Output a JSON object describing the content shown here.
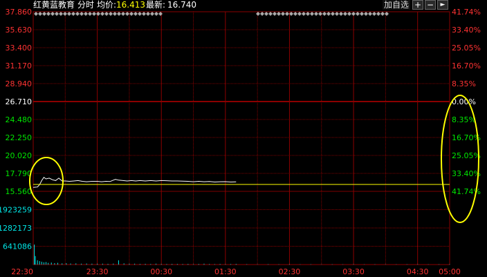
{
  "header": {
    "stock_name": "红黄蓝教育",
    "mode": "分时",
    "avg_label": "均价:",
    "avg_value": "16.413",
    "latest_label": "最新:",
    "latest_value": "16.740",
    "add_watchlist": "加自选",
    "btn_plus": "+",
    "btn_minus": "−",
    "btn_right": "►"
  },
  "colors": {
    "up": "#ff3232",
    "down": "#00e600",
    "grid": "#8c0000",
    "volume": "#00e6e6",
    "text": "#ffffff",
    "avg": "#ffff00",
    "price_line": "#ffffff",
    "annotation": "#ffff00"
  },
  "icons": {
    "plus": "plus-icon",
    "minus": "minus-icon",
    "right": "arrow-right-icon"
  },
  "chart_data": {
    "type": "line",
    "title": "",
    "prev_close": 26.71,
    "price_ticks": [
      "37.860",
      "35.630",
      "33.400",
      "31.170",
      "28.940",
      "26.710",
      "24.480",
      "22.250",
      "20.020",
      "17.790",
      "15.560"
    ],
    "percent_ticks": [
      "41.74%",
      "33.40%",
      "25.05%",
      "16.70%",
      "8.35%",
      "0.00%",
      "8.35%",
      "16.70%",
      "25.05%",
      "33.40%",
      "41.74%"
    ],
    "volume_ticks": [
      "1923259",
      "1282173",
      "641086"
    ],
    "time_ticks": [
      "22:30",
      "23:30",
      "00:30",
      "01:30",
      "02:30",
      "03:30",
      "04:30",
      "05:00"
    ],
    "ylim": [
      15.56,
      37.86
    ],
    "volume_max": 2564345,
    "price_series": [
      [
        0,
        16.05
      ],
      [
        4,
        16.1
      ],
      [
        6,
        16.4
      ],
      [
        8,
        16.9
      ],
      [
        10,
        17.3
      ],
      [
        12,
        17.1
      ],
      [
        15,
        17.2
      ],
      [
        18,
        17.0
      ],
      [
        21,
        16.9
      ],
      [
        24,
        17.2
      ],
      [
        27,
        16.85
      ],
      [
        30,
        16.85
      ],
      [
        34,
        16.8
      ],
      [
        38,
        16.85
      ],
      [
        42,
        16.9
      ],
      [
        46,
        16.8
      ],
      [
        50,
        16.75
      ],
      [
        55,
        16.8
      ],
      [
        60,
        16.8
      ],
      [
        64,
        16.75
      ],
      [
        68,
        16.8
      ],
      [
        72,
        16.78
      ],
      [
        75,
        16.95
      ],
      [
        77,
        17.05
      ],
      [
        80,
        16.95
      ],
      [
        84,
        16.9
      ],
      [
        88,
        16.85
      ],
      [
        92,
        16.9
      ],
      [
        96,
        16.85
      ],
      [
        100,
        16.9
      ],
      [
        105,
        16.85
      ],
      [
        110,
        16.9
      ],
      [
        115,
        16.85
      ],
      [
        120,
        16.9
      ],
      [
        125,
        16.88
      ],
      [
        130,
        16.85
      ],
      [
        135,
        16.85
      ],
      [
        140,
        16.82
      ],
      [
        145,
        16.8
      ],
      [
        150,
        16.75
      ],
      [
        155,
        16.8
      ],
      [
        160,
        16.75
      ],
      [
        165,
        16.78
      ],
      [
        170,
        16.72
      ],
      [
        175,
        16.75
      ],
      [
        180,
        16.76
      ],
      [
        185,
        16.72
      ],
      [
        190,
        16.74
      ]
    ],
    "avg_price": 16.413,
    "volume_series": [
      [
        1,
        700000
      ],
      [
        2,
        300000
      ],
      [
        4,
        150000
      ],
      [
        6,
        120000
      ],
      [
        8,
        100000
      ],
      [
        10,
        80000
      ],
      [
        12,
        90000
      ],
      [
        14,
        60000
      ],
      [
        17,
        70000
      ],
      [
        20,
        50000
      ],
      [
        23,
        60000
      ],
      [
        27,
        40000
      ],
      [
        31,
        45000
      ],
      [
        35,
        35000
      ],
      [
        40,
        40000
      ],
      [
        45,
        30000
      ],
      [
        50,
        35000
      ],
      [
        55,
        30000
      ],
      [
        60,
        28000
      ],
      [
        65,
        30000
      ],
      [
        70,
        25000
      ],
      [
        75,
        32000
      ],
      [
        80,
        150000
      ],
      [
        85,
        40000
      ],
      [
        90,
        28000
      ],
      [
        95,
        30000
      ],
      [
        100,
        22000
      ],
      [
        105,
        25000
      ],
      [
        110,
        20000
      ],
      [
        115,
        30000
      ],
      [
        120,
        20000
      ],
      [
        125,
        18000
      ],
      [
        130,
        22000
      ],
      [
        135,
        20000
      ],
      [
        140,
        18000
      ],
      [
        145,
        22000
      ],
      [
        150,
        15000
      ],
      [
        155,
        20000
      ],
      [
        160,
        30000
      ],
      [
        165,
        18000
      ],
      [
        170,
        15000
      ],
      [
        175,
        20000
      ],
      [
        180,
        15000
      ],
      [
        185,
        18000
      ],
      [
        190,
        22000
      ],
      [
        200,
        12000
      ],
      [
        210,
        10000
      ],
      [
        220,
        12000
      ],
      [
        230,
        10000
      ],
      [
        240,
        15000
      ],
      [
        250,
        8000
      ],
      [
        260,
        10000
      ],
      [
        270,
        8000
      ],
      [
        280,
        10000
      ],
      [
        290,
        8000
      ],
      [
        300,
        12000
      ],
      [
        310,
        8000
      ],
      [
        320,
        10000
      ],
      [
        330,
        10000
      ],
      [
        340,
        8000
      ],
      [
        350,
        10000
      ],
      [
        360,
        12000
      ],
      [
        370,
        8000
      ],
      [
        380,
        10000
      ],
      [
        390,
        15000
      ]
    ],
    "total_minutes": 390,
    "legend": "none",
    "grid": true
  }
}
